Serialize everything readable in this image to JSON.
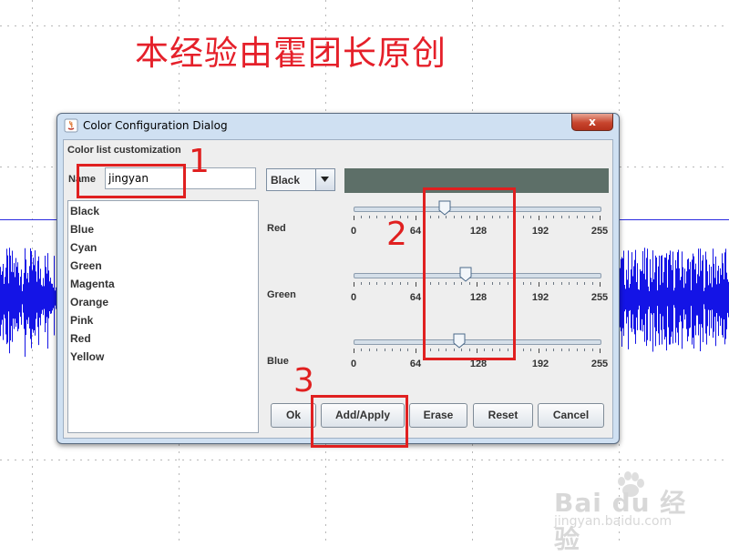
{
  "watermark_title": "本经验由霍团长原创",
  "dialog": {
    "title": "Color Configuration Dialog",
    "close_glyph": "x",
    "group_label": "Color list customization",
    "name_label": "Name",
    "name_value": "jingyan",
    "color_list": [
      "Black",
      "Blue",
      "Cyan",
      "Green",
      "Magenta",
      "Orange",
      "Pink",
      "Red",
      "Yellow"
    ],
    "combo_value": "Black",
    "swatch_color": "#5d6f68",
    "sliders": [
      {
        "label": "Red",
        "value": 0.37,
        "ticks": [
          "0",
          "64",
          "128",
          "192",
          "255"
        ]
      },
      {
        "label": "Green",
        "value": 0.455,
        "ticks": [
          "0",
          "64",
          "128",
          "192",
          "255"
        ]
      },
      {
        "label": "Blue",
        "value": 0.43,
        "ticks": [
          "0",
          "64",
          "128",
          "192",
          "255"
        ]
      }
    ],
    "buttons": {
      "ok": "Ok",
      "add_apply": "Add/Apply",
      "erase": "Erase",
      "reset": "Reset",
      "cancel": "Cancel"
    }
  },
  "annotations": {
    "n1": "1",
    "n2": "2",
    "n3": "3",
    "color": "#e02020"
  },
  "watermark": {
    "logo": "Bai du 经验",
    "sub": "jingyan.baidu.com"
  },
  "icons": [
    "java-app-icon",
    "close-icon",
    "chevron-down-icon",
    "slider-thumb-icon",
    "paw-icon"
  ]
}
